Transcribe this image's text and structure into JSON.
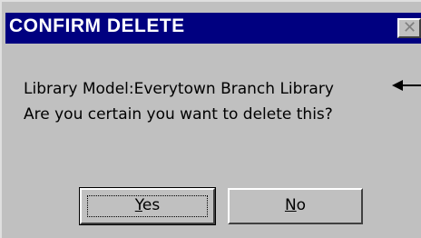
{
  "dialog": {
    "title": "CONFIRM DELETE",
    "close_glyph": "✕",
    "message_line1": "Library Model:Everytown Branch Library",
    "message_line2": "Are you certain you want to delete this?",
    "buttons": {
      "yes": {
        "mnemonic": "Y",
        "rest": "es"
      },
      "no": {
        "mnemonic": "N",
        "rest": "o"
      }
    }
  },
  "colors": {
    "titlebar": "#000080",
    "face": "#c0c0c0"
  }
}
